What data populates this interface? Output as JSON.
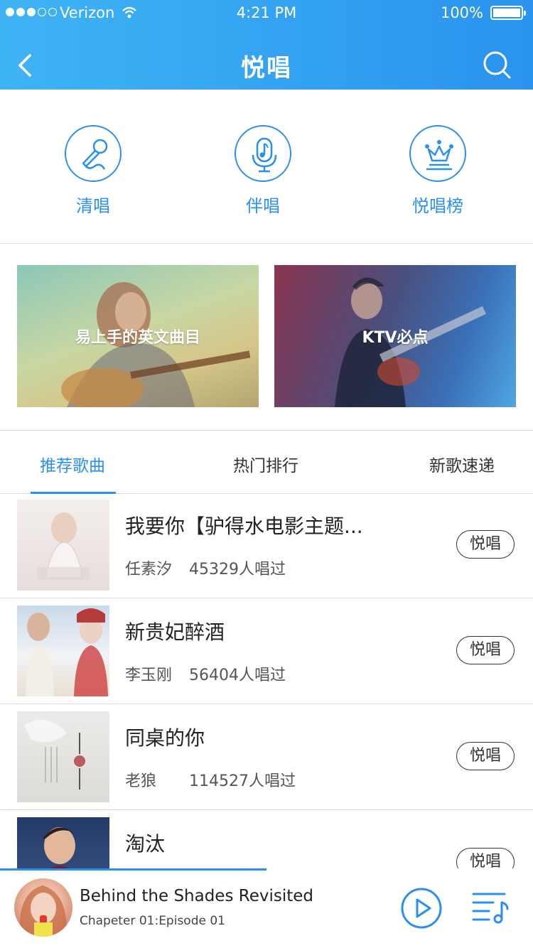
{
  "status_bar": {
    "carrier": "Verizon",
    "time": "4:21 PM",
    "battery": "100%"
  },
  "header": {
    "title": "悦唱"
  },
  "features": [
    {
      "label": "清唱",
      "icon": "microphone-icon"
    },
    {
      "label": "伴唱",
      "icon": "music-note-mic-icon"
    },
    {
      "label": "悦唱榜",
      "icon": "crown-icon"
    }
  ],
  "banners": [
    {
      "label": "易上手的英文曲目"
    },
    {
      "label": "KTV必点"
    }
  ],
  "tabs": [
    "推荐歌曲",
    "热门排行",
    "新歌速递"
  ],
  "songs": [
    {
      "title": "我要你【驴得水电影主题...",
      "artist": "任素汐",
      "count": "45329人唱过",
      "button": "悦唱"
    },
    {
      "title": "新贵妃醉酒",
      "artist": "李玉刚",
      "count": "56404人唱过",
      "button": "悦唱"
    },
    {
      "title": "同桌的你",
      "artist": "老狼",
      "count": "114527人唱过",
      "button": "悦唱"
    },
    {
      "title": "淘汰",
      "artist": "",
      "count": "",
      "button": "悦唱"
    }
  ],
  "player": {
    "title": "Behind the Shades Revisited",
    "subtitle": "Chapeter 01:Episode 01",
    "progress": 0.5
  },
  "colors": {
    "accent": "#2a8ff0",
    "header_start": "#3fb4f5",
    "header_end": "#2a93ee"
  }
}
